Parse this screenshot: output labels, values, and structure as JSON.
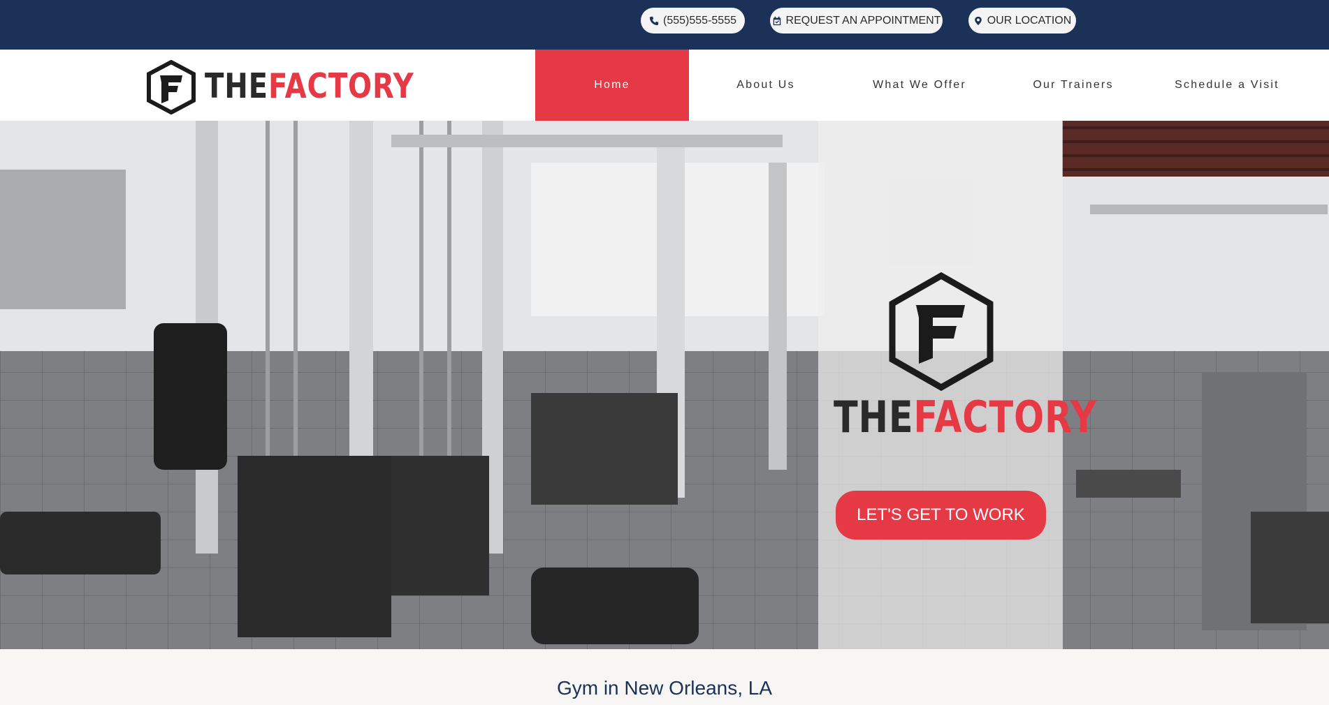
{
  "topbar": {
    "phone_label": "(555)555-5555",
    "appointment_label": "REQUEST AN APPOINTMENT",
    "location_label": "OUR LOCATION",
    "icons": [
      "phone-icon",
      "calendar-check-icon",
      "map-marker-icon"
    ]
  },
  "brand": {
    "name_part1": "THE",
    "name_part2": "FACTORY",
    "accent_color": "#e63946",
    "navy_color": "#1c3157"
  },
  "nav": {
    "items": [
      {
        "label": "Home",
        "active": true
      },
      {
        "label": "About Us"
      },
      {
        "label": "What We Offer"
      },
      {
        "label": "Our Trainers"
      },
      {
        "label": "Schedule a Visit"
      }
    ]
  },
  "hero": {
    "cta_label": "LET'S GET TO WORK"
  },
  "intro": {
    "tagline": "Gym in New Orleans, LA"
  }
}
